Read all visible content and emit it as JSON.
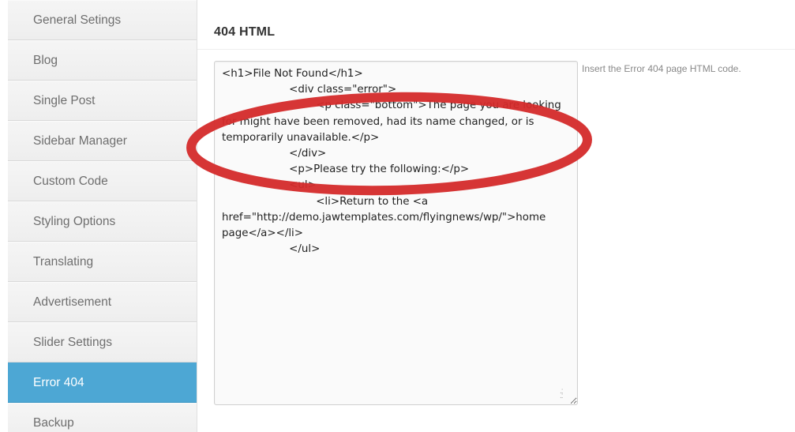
{
  "sidebar": {
    "items": [
      {
        "label": "General Setings",
        "active": false
      },
      {
        "label": "Blog",
        "active": false
      },
      {
        "label": "Single Post",
        "active": false
      },
      {
        "label": "Sidebar Manager",
        "active": false
      },
      {
        "label": "Custom Code",
        "active": false
      },
      {
        "label": "Styling Options",
        "active": false
      },
      {
        "label": "Translating",
        "active": false
      },
      {
        "label": "Advertisement",
        "active": false
      },
      {
        "label": "Slider Settings",
        "active": false
      },
      {
        "label": "Error 404",
        "active": true
      },
      {
        "label": "Backup",
        "active": false
      }
    ]
  },
  "main": {
    "section_title": "404 HTML",
    "editor_value": "<h1>File Not Found</h1>\n                    <div class=\"error\">\n                            <p class=\"bottom\">The page you are looking for might have been removed, had its name changed, or is temporarily unavailable.</p>\n                    </div>\n                    <p>Please try the following:</p>\n                    <ul>\n                            <li>Return to the <a href=\"http://demo.jawtemplates.com/flyingnews/wp/\">home page</a></li>\n                    </ul>",
    "hint": "Insert the Error 404 page HTML code."
  },
  "colors": {
    "active_item": "#4da7d4",
    "annotation_ellipse": "#d42a2a"
  },
  "icons": {
    "resize_grip": "resize-grip-icon"
  }
}
